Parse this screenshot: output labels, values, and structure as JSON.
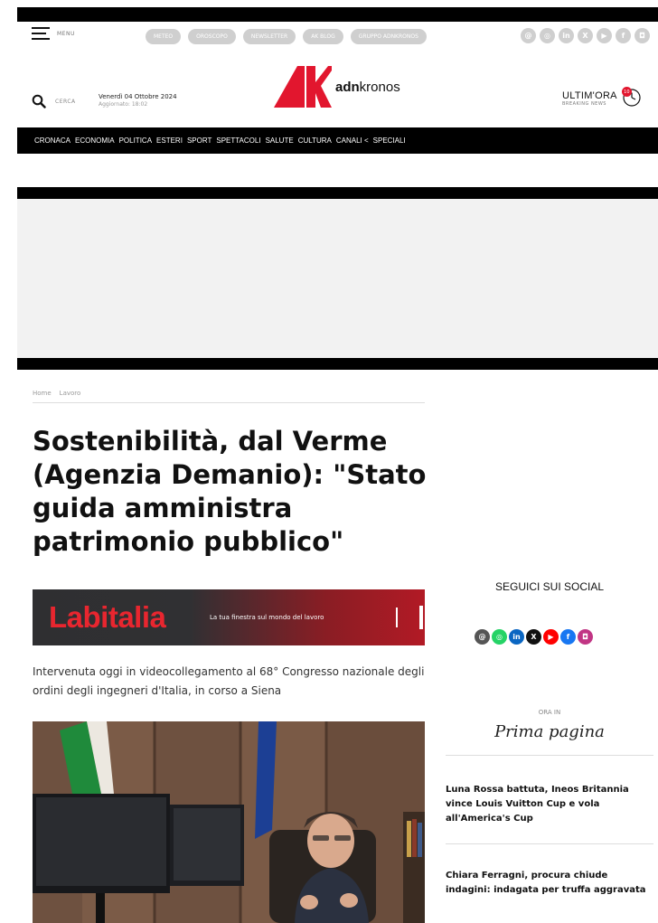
{
  "header": {
    "menu_label": "MENU",
    "pills": [
      "METEO",
      "OROSCOPO",
      "NEWSLETTER",
      "AK BLOG",
      "GRUPPO ADNKRONOS"
    ],
    "social_icons": [
      "threads-icon",
      "whatsapp-icon",
      "linkedin-icon",
      "x-icon",
      "youtube-icon",
      "facebook-icon",
      "instagram-icon"
    ],
    "search_label": "CERCA",
    "date": "Venerdì 04 Ottobre 2024",
    "updated": "Aggiornato: 18:02",
    "logo_bold": "adn",
    "logo_rest": "kronos",
    "ultimora_title": "ULTIM'ORA",
    "ultimora_sub": "BREAKING NEWS",
    "ultimora_badge": "10"
  },
  "nav": [
    "CRONACA",
    "ECONOMIA",
    "POLITICA",
    "ESTERI",
    "SPORT",
    "SPETTACOLI",
    "SALUTE",
    "CULTURA",
    "CANALI <",
    "SPECIALI"
  ],
  "breadcrumb": [
    "Home",
    "Lavoro"
  ],
  "article": {
    "title": "Sostenibilità, dal Verme (Agenzia Demanio): \"Stato guida amministra patrimonio pubblico\"",
    "banner_brand": "Labitalia",
    "banner_tagline": "La tua finestra sul mondo del lavoro",
    "summary": "Intervenuta oggi in videocollegamento al 68° Congresso nazionale degli ordini degli ingegneri d'Italia, in corso a Siena"
  },
  "sidebar": {
    "social_title": "SEGUICI SUI SOCIAL",
    "ora_in": "ORA IN",
    "prima_pagina": "Prima pagina",
    "news": [
      "Luna Rossa battuta, Ineos Britannia vince Louis Vuitton Cup e vola all'America's Cup",
      "Chiara Ferragni, procura chiude indagini: indagata per truffa aggravata"
    ]
  },
  "colors": {
    "brand_red": "#e2162e",
    "nav_bg": "#000000",
    "pill_gray": "#cfcfcf",
    "social": {
      "threads": "#555555",
      "whatsapp": "#25d366",
      "linkedin": "#0a66c2",
      "x": "#111111",
      "youtube": "#ff0000",
      "facebook": "#1877f2",
      "instagram": "#c13584"
    }
  }
}
